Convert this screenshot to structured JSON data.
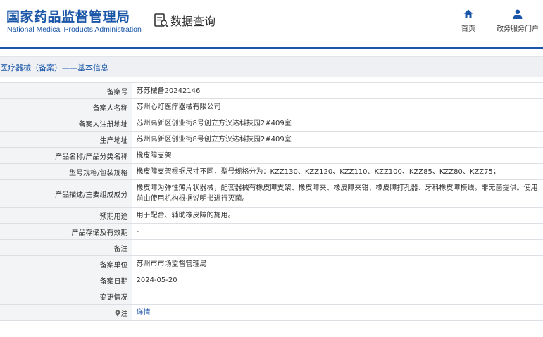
{
  "header": {
    "logo_cn": "国家药品监督管理局",
    "logo_en": "National Medical Products Administration",
    "query_title": "数据查询",
    "nav": {
      "home_label": "首页",
      "service_label": "政务服务门户"
    }
  },
  "section": {
    "title": "医疗器械（备案）——基本信息"
  },
  "fields": [
    {
      "label": "备案号",
      "value": "苏苏械备20242146"
    },
    {
      "label": "备案人名称",
      "value": "苏州心灯医疗器械有限公司"
    },
    {
      "label": "备案人注册地址",
      "value": "苏州高新区创业街8号创立方汉达科技园2#409室"
    },
    {
      "label": "生产地址",
      "value": "苏州高新区创业街8号创立方汉达科技园2#409室"
    },
    {
      "label": "产品名称/产品分类名称",
      "value": "橡皮障支架"
    },
    {
      "label": "型号规格/包装规格",
      "value": "橡皮障支架根据尺寸不同，型号规格分为：KZZ130、KZZ120、KZZ110、KZZ100、KZZ85、KZZ80、KZZ75；"
    },
    {
      "label": "产品描述/主要组成成分",
      "value": "橡皮障为弹性薄片状器械，配套器械有橡皮障支架、橡皮障夹、橡皮障夹钳、橡皮障打孔器、牙科橡皮障模线。非无菌提供。使用前由使用机构根据说明书进行灭菌。"
    },
    {
      "label": "预期用途",
      "value": "用于配合、辅助橡皮障的施用。"
    },
    {
      "label": "产品存储及有效期",
      "value": "-"
    },
    {
      "label": "备注",
      "value": ""
    },
    {
      "label": "备案单位",
      "value": "苏州市市场监督管理局"
    },
    {
      "label": "备案日期",
      "value": "2024-05-20"
    },
    {
      "label": "变更情况",
      "value": ""
    },
    {
      "label": "注",
      "value": "详情"
    }
  ],
  "colors": {
    "brand_blue": "#1a56a8",
    "label_bg": "#f3f4f6",
    "section_bg": "#eef0f3",
    "border": "#dcdfe4"
  },
  "icons": {
    "query": "document-search-icon",
    "home": "home-icon",
    "service": "user-icon",
    "note": "map-pin-icon"
  }
}
